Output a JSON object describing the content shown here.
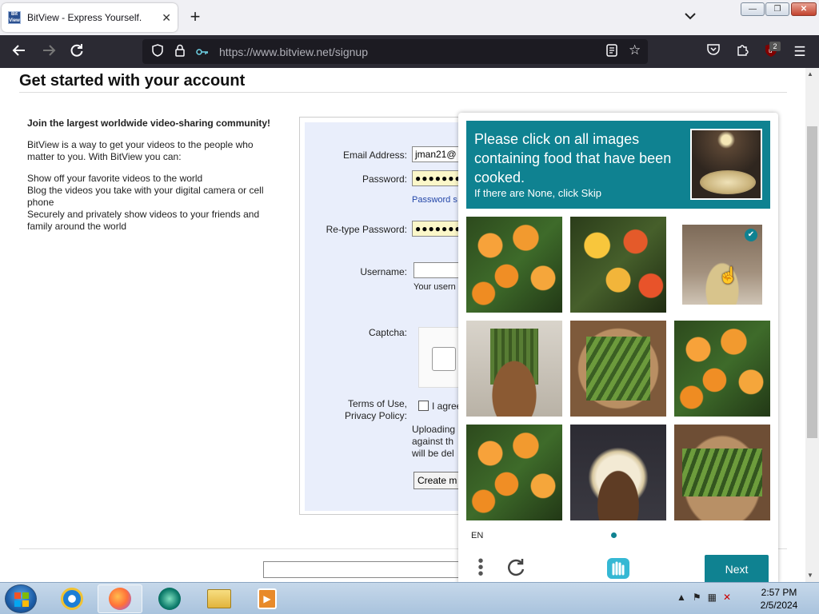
{
  "browser": {
    "tab_title": "BitView - Express Yourself.",
    "favicon_text": "Bit View",
    "url": "https://www.bitview.net/signup",
    "extension_badge": "2"
  },
  "page": {
    "heading": "Get started with your account",
    "intro_bold": "Join the largest worldwide video-sharing community!",
    "intro_text": "BitView is a way to get your videos to the people who matter to you. With BitView you can:",
    "features": [
      "Show off your favorite videos to the world",
      "Blog the videos you take with your digital camera or cell phone",
      "Securely and privately show videos to your friends and family around the world"
    ],
    "form": {
      "email_label": "Email Address:",
      "email_value": "jman21@",
      "password_label": "Password:",
      "password_value": "●●●●●●●",
      "password_hint": "Password s",
      "retype_label": "Re-type Password:",
      "retype_value": "●●●●●●●",
      "username_label": "Username:",
      "username_hint": "Your usern",
      "captcha_label": "Captcha:",
      "terms_label": "Terms of Use,",
      "privacy_label": "Privacy Policy:",
      "agree_text": "I agree",
      "upload_line1": "Uploading",
      "upload_line2": "against th",
      "upload_line3": "will be del",
      "create_button": "Create m"
    }
  },
  "captcha": {
    "prompt": "Please click on all images containing food that have been cooked.",
    "sub": "If there are None, click Skip",
    "lang": "EN",
    "next_label": "Next",
    "check_mark": "✔",
    "selected_tile_index": 2
  },
  "taskbar": {
    "time": "2:57 PM",
    "date": "2/5/2024"
  }
}
